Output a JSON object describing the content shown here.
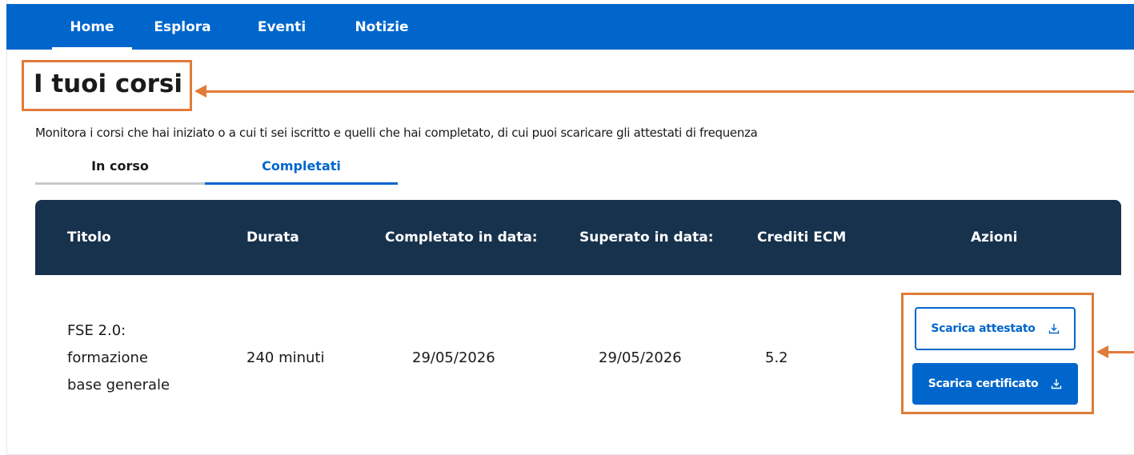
{
  "nav": {
    "items": [
      {
        "label": "Home",
        "active": true
      },
      {
        "label": "Esplora",
        "active": false
      },
      {
        "label": "Eventi",
        "active": false
      },
      {
        "label": "Notizie",
        "active": false
      }
    ]
  },
  "page": {
    "title": "I tuoi corsi",
    "subtitle": "Monitora i corsi che hai iniziato o a cui ti sei iscritto e quelli che hai completato, di cui puoi scaricare gli attestati di frequenza"
  },
  "tabs": [
    {
      "label": "In corso",
      "active": false
    },
    {
      "label": "Completati",
      "active": true
    }
  ],
  "table": {
    "headers": [
      "Titolo",
      "Durata",
      "Completato in data:",
      "Superato in data:",
      "Crediti ECM",
      "Azioni"
    ],
    "rows": [
      {
        "title_lines": [
          "FSE 2.0:",
          "formazione",
          "base generale"
        ],
        "duration": "240 minuti",
        "completed": "29/05/2026",
        "passed": "29/05/2026",
        "credits": "5.2",
        "actions": {
          "download_attestato": "Scarica attestato",
          "download_certificato": "Scarica certificato"
        }
      }
    ]
  },
  "icons": {
    "download": "download-icon"
  },
  "colors": {
    "primary": "#0066cc",
    "header_dark": "#17324d",
    "highlight": "#e07b39"
  }
}
